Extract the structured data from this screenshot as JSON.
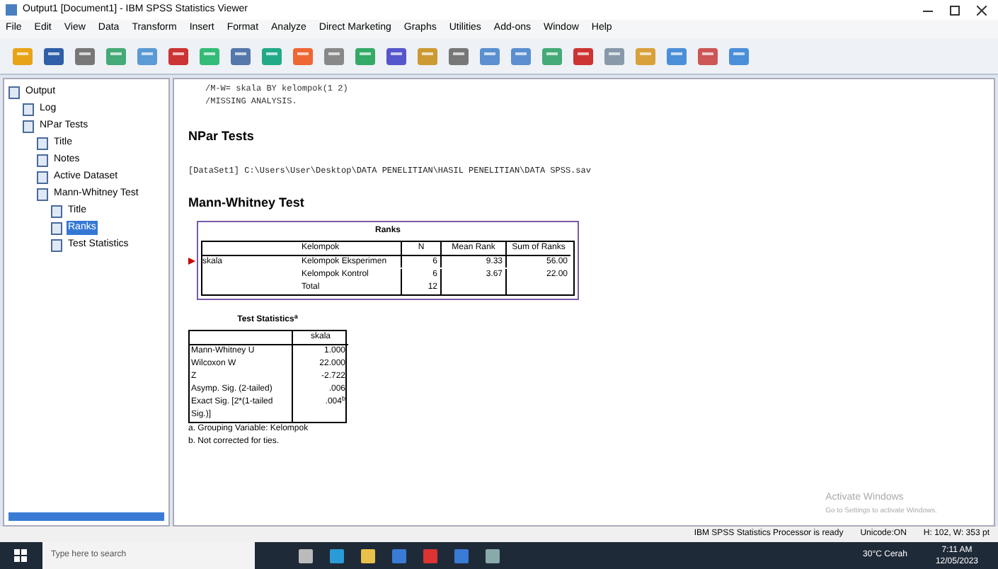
{
  "window": {
    "title": "Output1 [Document1] - IBM SPSS Statistics Viewer"
  },
  "menu": [
    "File",
    "Edit",
    "View",
    "Data",
    "Transform",
    "Insert",
    "Format",
    "Analyze",
    "Direct Marketing",
    "Graphs",
    "Utilities",
    "Add-ons",
    "Window",
    "Help"
  ],
  "outline": [
    {
      "label": "Output",
      "selected": false,
      "children": [
        {
          "label": "Log",
          "selected": false
        },
        {
          "label": "NPar Tests",
          "selected": false,
          "children": [
            {
              "label": "Title",
              "selected": false
            },
            {
              "label": "Notes",
              "selected": false
            },
            {
              "label": "Active Dataset",
              "selected": false
            },
            {
              "label": "Mann-Whitney Test",
              "selected": false,
              "children": [
                {
                  "label": "Title",
                  "selected": false
                },
                {
                  "label": "Ranks",
                  "selected": true
                },
                {
                  "label": "Test Statistics",
                  "selected": false
                }
              ]
            }
          ]
        }
      ]
    }
  ],
  "log_lines": [
    "/M-W= skala BY kelompok(1 2)",
    "/MISSING ANALYSIS."
  ],
  "heading": "NPar Tests",
  "dataset_line": "[DataSet1] C:\\Users\\User\\Desktop\\DATA PENELITIAN\\HASIL PENELITIAN\\DATA SPSS.sav",
  "subheading": "Mann-Whitney Test",
  "ranks": {
    "title": "Ranks",
    "columns": [
      "Kelompok",
      "N",
      "Mean Rank",
      "Sum of Ranks"
    ],
    "row_label": "skala",
    "rows": [
      [
        "Kelompok Eksperimen",
        "6",
        "9.33",
        "56.00"
      ],
      [
        "Kelompok Kontrol",
        "6",
        "3.67",
        "22.00"
      ],
      [
        "Total",
        "12",
        "",
        ""
      ]
    ]
  },
  "test_stats": {
    "title": "Test Statistics",
    "title_mark": "a",
    "column": "skala",
    "rows": [
      {
        "label": "Mann-Whitney U",
        "value": "1.000",
        "mark": ""
      },
      {
        "label": "Wilcoxon W",
        "value": "22.000",
        "mark": ""
      },
      {
        "label": "Z",
        "value": "-2.722",
        "mark": ""
      },
      {
        "label": "Asymp. Sig. (2-tailed)",
        "value": ".006",
        "mark": ""
      },
      {
        "label": "Exact Sig. [2*(1-tailed Sig.)]",
        "value": ".004",
        "mark": "b"
      }
    ],
    "footnotes": [
      "a. Grouping Variable: Kelompok",
      "b. Not corrected for ties."
    ]
  },
  "activation": [
    "Activate Windows",
    "Go to Settings to activate Windows."
  ],
  "status_bar": [
    "IBM SPSS Statistics Processor is ready",
    "Unicode:ON",
    "H: 102, W: 353 pt"
  ],
  "taskbar": {
    "search_placeholder": "Type here to search",
    "weather": "30°C Cerah",
    "time": "7:11 AM",
    "date": "12/05/2023"
  }
}
